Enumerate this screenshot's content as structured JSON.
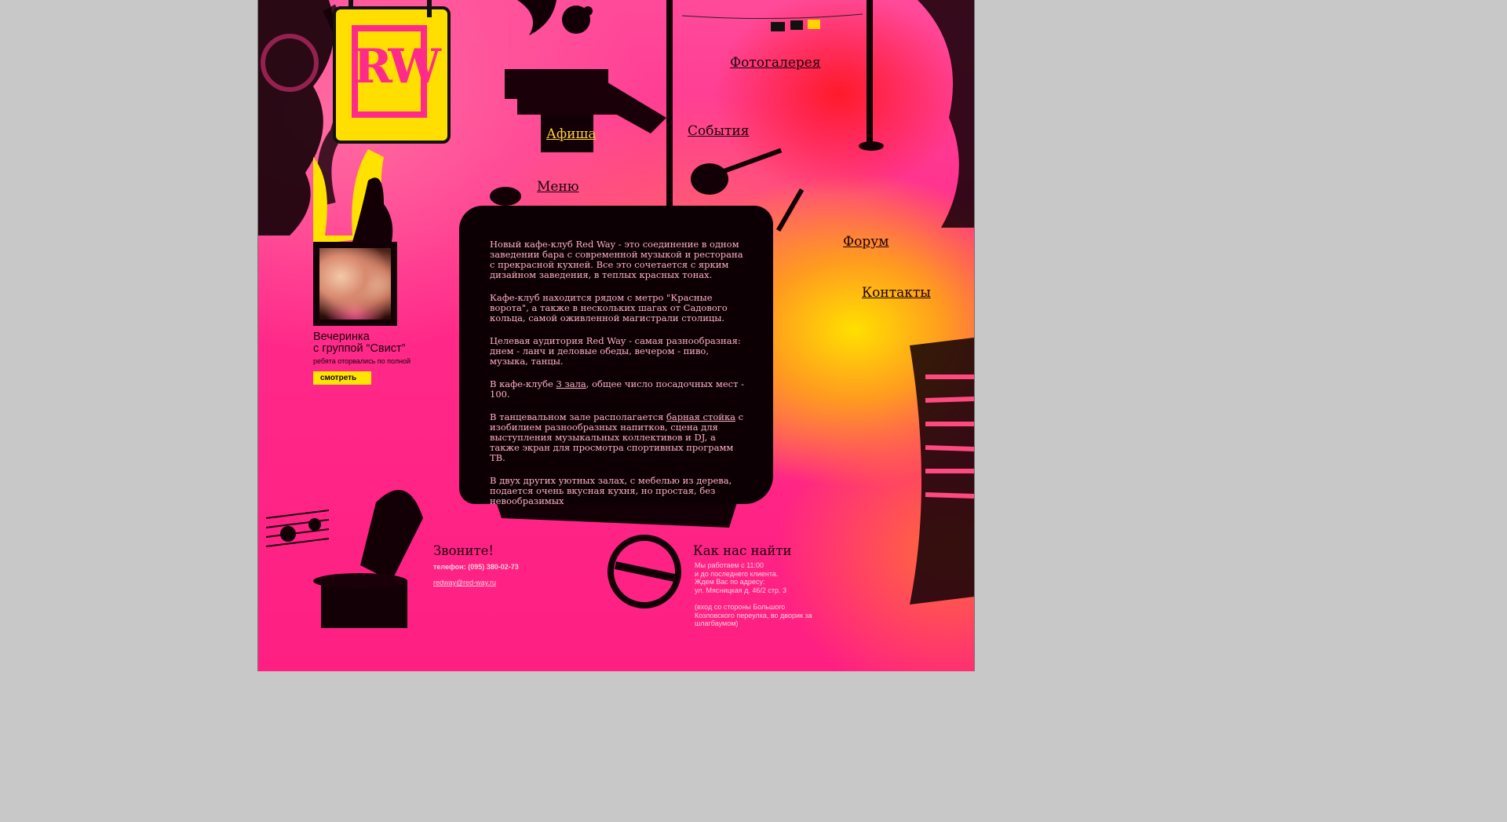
{
  "colors": {
    "accent_yellow": "#ffe600",
    "pink": "#ff2a8a",
    "black": "#0c0004",
    "text_pink": "#ffb1c6"
  },
  "logo": {
    "text": "RW"
  },
  "nav": {
    "photogallery": "Фотогалерея",
    "afisha": "Афиша",
    "events": "События",
    "menu": "Меню",
    "forum": "Форум",
    "contacts": "Контакты"
  },
  "promo": {
    "title_line1": "Вечеринка",
    "title_line2": "с группой “Свист”",
    "subtitle": "ребята оторвались по полной",
    "button_label": "смотреть"
  },
  "content": {
    "p1": "Новый кафе-клуб Red Way - это соединение в одном заведении бара с современной музыкой и ресторана с прекрасной кухней. Все это сочетается с ярким дизайном заведения, в теплых красных тонах.",
    "p2": "Кафе-клуб находится рядом с метро \"Красные ворота\", а также в нескольких шагах от Садового кольца, самой оживленной магистрали столицы.",
    "p3": "Целевая аудитория Red Way - самая разнообразная: днем - ланч и деловые обеды, вечером - пиво, музыка, танцы.",
    "p4_before": "В кафе-клубе ",
    "p4_link": "3 зала",
    "p4_after": ", общее число посадочных мест - 100.",
    "p5_before": "В танцевальном зале располагается ",
    "p5_link": "барная стойка",
    "p5_after": " с изобилием разнообразных напитков, сцена для выступления музыкальных коллективов и DJ, а также экран для просмотра спортивных программ ТВ.",
    "p6": "В двух других уютных залах, с мебелью из дерева, подается очень вкусная кухня, но простая, без невообразимых"
  },
  "call": {
    "title": "Звоните!",
    "phone": "телефон: (095) 380-02-73",
    "email": "redway@red-way.ru"
  },
  "find": {
    "title": "Как нас найти",
    "line1": "Мы работаем с 11:00",
    "line2": "и до последнего клиента.",
    "line3": "Ждем Вас по адресу:",
    "line4": "ул. Мясницкая д. 46/2 стр. 3",
    "line5": "(вход со стороны Большого",
    "line6": "Козловского переулка, во дворик за",
    "line7": "шлагбаумом)"
  }
}
